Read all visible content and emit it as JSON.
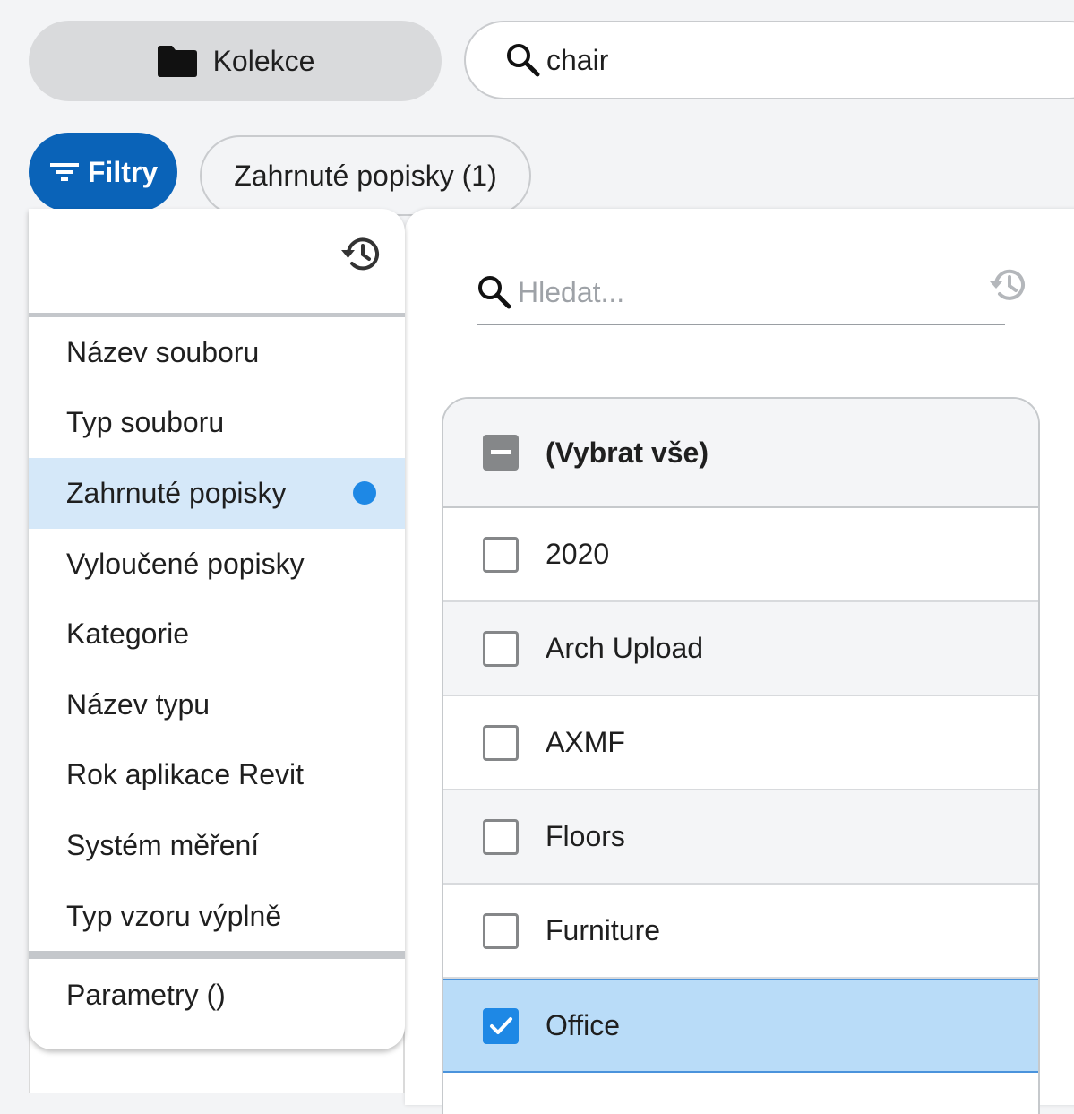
{
  "toolbar": {
    "collection_label": "Kolekce",
    "search_value": "chair"
  },
  "filters": {
    "button_label": "Filtry",
    "active_chip": "Zahrnuté popisky (1)"
  },
  "left_panel": {
    "items": [
      {
        "label": "Název souboru"
      },
      {
        "label": "Typ souboru"
      },
      {
        "label": "Zahrnuté popisky",
        "active": true
      },
      {
        "label": "Vyloučené popisky"
      },
      {
        "label": "Kategorie"
      },
      {
        "label": "Název typu"
      },
      {
        "label": "Rok aplikace Revit"
      },
      {
        "label": "Systém měření"
      },
      {
        "label": "Typ vzoru výplně"
      }
    ],
    "params_label": "Parametry ()"
  },
  "right_panel": {
    "search_placeholder": "Hledat...",
    "select_all_label": "(Vybrat vše)",
    "options": [
      {
        "label": "2020",
        "checked": false
      },
      {
        "label": "Arch Upload",
        "checked": false
      },
      {
        "label": "AXMF",
        "checked": false
      },
      {
        "label": "Floors",
        "checked": false
      },
      {
        "label": "Furniture",
        "checked": false
      },
      {
        "label": "Office",
        "checked": true
      }
    ]
  },
  "colors": {
    "primary": "#0a63b8",
    "active_bg": "#d5e8f9",
    "selected_row": "#b9dcf8",
    "checkbox_checked": "#1e88e5"
  }
}
